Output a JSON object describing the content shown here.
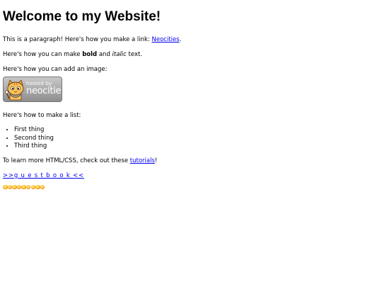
{
  "heading": "Welcome to my Website!",
  "paragraph_link": {
    "before": "This is a paragraph! Here's how you make a link: ",
    "link_text": "Neocities",
    "after": "."
  },
  "paragraph_format": {
    "before": "Here's how you can make ",
    "bold": "bold",
    "middle": " and ",
    "italic": "italic",
    "after": " text."
  },
  "paragraph_image": "Here's how you can add an image:",
  "badge": {
    "small_text": "hosted by",
    "big_text": "neocities",
    "icon": "neocities-cat-icon"
  },
  "paragraph_list": "Here's how to make a list:",
  "list_items": [
    "First thing",
    "Second thing",
    "Third thing"
  ],
  "paragraph_learn": {
    "before": "To learn more HTML/CSS, check out these ",
    "link_text": "tutorials",
    "after": "!"
  },
  "guestbook_link": ">>g u e s t b o o k <<",
  "decorations": {
    "icon": "sun-icon",
    "count": 9,
    "color": "#f19a16"
  },
  "colors": {
    "link": "#0000ee",
    "text": "#000000",
    "background": "#ffffff"
  }
}
